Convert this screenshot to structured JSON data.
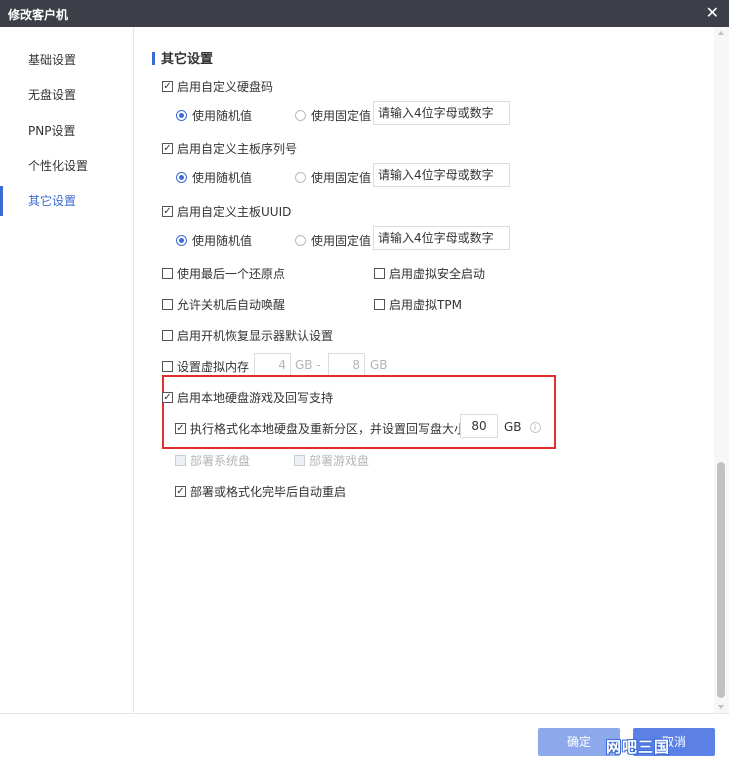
{
  "window": {
    "title": "修改客户机",
    "close_glyph": "✕"
  },
  "sidebar": {
    "items": [
      {
        "label": "基础设置"
      },
      {
        "label": "无盘设置"
      },
      {
        "label": "PNP设置"
      },
      {
        "label": "个性化设置"
      },
      {
        "label": "其它设置",
        "active": true
      }
    ]
  },
  "section": {
    "title": "其它设置"
  },
  "hdd_code": {
    "label": "启用自定义硬盘码",
    "checked": true,
    "random_label": "使用随机值",
    "fixed_label": "使用固定值",
    "placeholder": "请输入4位字母或数字"
  },
  "board_serial": {
    "label": "启用自定义主板序列号",
    "checked": true,
    "random_label": "使用随机值",
    "fixed_label": "使用固定值",
    "placeholder": "请输入4位字母或数字"
  },
  "board_uuid": {
    "label": "启用自定义主板UUID",
    "checked": true,
    "random_label": "使用随机值",
    "fixed_label": "使用固定值",
    "placeholder": "请输入4位字母或数字"
  },
  "options": {
    "last_restore": "使用最后一个还原点",
    "secure_boot": "启用虚拟安全启动",
    "wake_after_shutdown": "允许关机后自动唤醒",
    "virtual_tpm": "启用虚拟TPM",
    "restore_display": "启用开机恢复显示器默认设置"
  },
  "virtual_memory": {
    "label": "设置虚拟内存",
    "min": "4",
    "max": "8",
    "unit1": "GB -",
    "unit2": "GB"
  },
  "local_disk": {
    "label": "启用本地硬盘游戏及回写支持",
    "checked": true,
    "format_label": "执行格式化本地硬盘及重新分区，并设置回写盘大小",
    "format_checked": true,
    "size": "80",
    "unit": "GB",
    "info_glyph": "i",
    "deploy_system": "部署系统盘",
    "deploy_game": "部署游戏盘"
  },
  "auto_restart": {
    "label": "部署或格式化完毕后自动重启",
    "checked": true
  },
  "footer": {
    "ok": "确定",
    "cancel": "取消"
  },
  "watermark": "网吧三国",
  "colors": {
    "accent": "#3b6bd6",
    "titlebar": "#3c3f47",
    "highlight": "#e0302d"
  }
}
